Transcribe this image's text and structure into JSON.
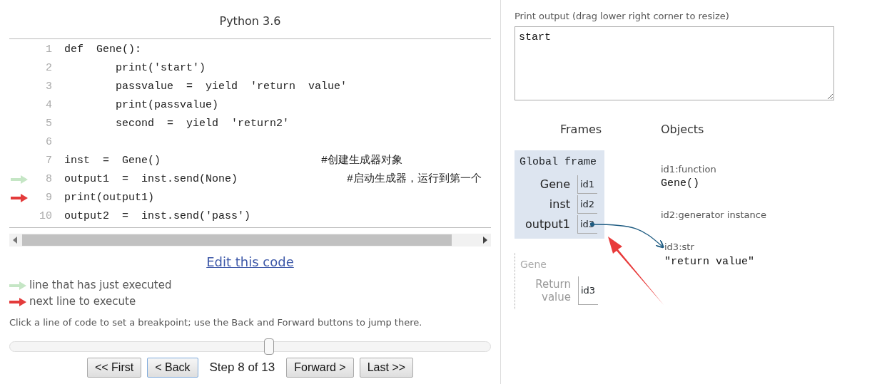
{
  "header": {
    "title": "Python 3.6"
  },
  "code_lines": [
    {
      "number": "1",
      "text": "def  Gene():",
      "just_executed": false,
      "next_to_execute": false
    },
    {
      "number": "2",
      "text": "        print('start')",
      "just_executed": false,
      "next_to_execute": false
    },
    {
      "number": "3",
      "text": "        passvalue  =  yield  'return  value'",
      "just_executed": false,
      "next_to_execute": false
    },
    {
      "number": "4",
      "text": "        print(passvalue)",
      "just_executed": false,
      "next_to_execute": false
    },
    {
      "number": "5",
      "text": "        second  =  yield  'return2'",
      "just_executed": false,
      "next_to_execute": false
    },
    {
      "number": "6",
      "just_executed": false,
      "next_to_execute": false
    },
    {
      "number": "7",
      "text": "inst  =  Gene()                         #创建生成器对象",
      "just_executed": false,
      "next_to_execute": false
    },
    {
      "number": "8",
      "text": "output1  =  inst.send(None)                 #启动生成器，运行到第一个",
      "just_executed": true,
      "next_to_execute": false
    },
    {
      "number": "9",
      "text": "print(output1)",
      "just_executed": false,
      "next_to_execute": true
    },
    {
      "number": "10",
      "text": "output2  =  inst.send('pass')",
      "just_executed": false,
      "next_to_execute": false
    }
  ],
  "edit_link": "Edit this code",
  "legend": [
    {
      "kind": "executed",
      "label": "line that has just executed"
    },
    {
      "kind": "next",
      "label": "next line to execute"
    }
  ],
  "hint": "Click a line of code to set a breakpoint; use the Back and Forward buttons to jump there.",
  "slider": {
    "level": 0.54
  },
  "controls": [
    {
      "kind": "button",
      "label": "<< First",
      "focused": false
    },
    {
      "kind": "button",
      "label": "< Back",
      "focused": true
    },
    {
      "kind": "text",
      "label": "Step 8 of 13"
    },
    {
      "kind": "button",
      "label": "Forward >",
      "focused": false
    },
    {
      "kind": "button",
      "label": "Last >>",
      "focused": false
    }
  ],
  "print_output": {
    "label": "Print output (drag lower right corner to resize)",
    "value": "start"
  },
  "frames_heading": "Frames",
  "objects_heading": "Objects",
  "frames": [
    {
      "name": "Global frame",
      "active": true,
      "vars": [
        {
          "name": "Gene",
          "value": "id1"
        },
        {
          "name": "inst",
          "value": "id2"
        },
        {
          "name": "output1",
          "value": "id3"
        }
      ]
    },
    {
      "name": "Gene",
      "active": false,
      "vars": [
        {
          "name": "Return value",
          "value": "id3"
        }
      ]
    }
  ],
  "objects": [
    {
      "label": "id1:function",
      "value": "Gene()"
    },
    {
      "label": "id2:generator instance"
    },
    {
      "label": "id3:str",
      "value": "\"return  value\""
    }
  ]
}
